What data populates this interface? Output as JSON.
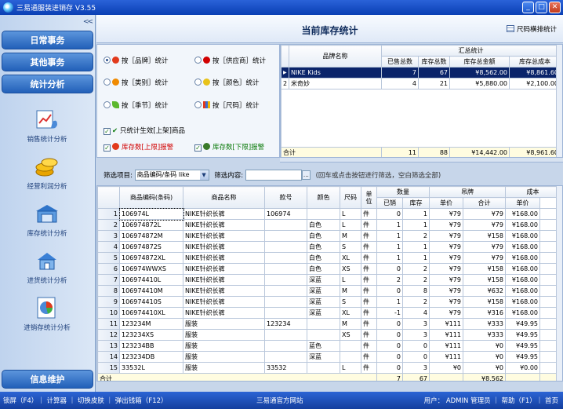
{
  "window": {
    "title": "三易通服装进销存 V3.55",
    "min": "_",
    "max": "□",
    "close": "✕"
  },
  "sidebar": {
    "collapse": "<<",
    "buttons": [
      "日常事务",
      "其他事务",
      "统计分析"
    ],
    "items": [
      {
        "label": "销售统计分析",
        "icon": "sales-chart-icon"
      },
      {
        "label": "经营利润分析",
        "icon": "coins-icon"
      },
      {
        "label": "库存统计分析",
        "icon": "warehouse-icon"
      },
      {
        "label": "进货统计分析",
        "icon": "house-icon"
      },
      {
        "label": "进销存统计分析",
        "icon": "pie-report-icon"
      }
    ],
    "bottom_button": "信息维护"
  },
  "header": {
    "title": "当前库存统计",
    "size_button": "尺码横排统计"
  },
  "options": {
    "radios": [
      {
        "label": "按［品牌］统计",
        "checked": true,
        "color": "#e23a1c"
      },
      {
        "label": "按［供应商］统计",
        "checked": false,
        "color": "#d10000"
      },
      {
        "label": "按［类别］统计",
        "checked": false,
        "color": "#f08a00"
      },
      {
        "label": "按［颜色］统计",
        "checked": false,
        "color": "#e8c21a"
      },
      {
        "label": "按［季节］统计",
        "checked": false,
        "color": "#5cb82e"
      },
      {
        "label": "按［尺码］统计",
        "checked": false,
        "color": "#3a6fd1"
      }
    ],
    "checks": [
      {
        "label": "只统计生效[上架]商品",
        "checked": true
      },
      {
        "label": "库存数[上限]报警",
        "checked": true
      },
      {
        "label": "库存数[下限]报警",
        "checked": true
      }
    ]
  },
  "brand_table": {
    "group_header": "汇总统计",
    "headers": [
      "品牌名称",
      "已售总数",
      "库存总数",
      "库存总金额",
      "库存总成本"
    ],
    "rows": [
      {
        "idx": "1",
        "name": "NIKE Kids",
        "sold": "7",
        "stock": "67",
        "amount": "¥8,562.00",
        "cost": "¥8,861.60",
        "selected": true
      },
      {
        "idx": "2",
        "name": "米奇妙",
        "sold": "4",
        "stock": "21",
        "amount": "¥5,880.00",
        "cost": "¥2,100.00",
        "selected": false
      }
    ],
    "total": {
      "label": "合计",
      "sold": "11",
      "stock": "88",
      "amount": "¥14,442.00",
      "cost": "¥8,961.60"
    }
  },
  "filter": {
    "label": "筛选项目:",
    "select_value": "商品编码/条码 like",
    "content_label": "筛选内容:",
    "hint": "(回车或点击按钮进行筛选，空白筛选全部)"
  },
  "grid": {
    "headers": {
      "code": "商品编码(条码)",
      "name": "商品名称",
      "style": "款号",
      "color": "颜色",
      "size": "尺码",
      "unit": "单位",
      "qty_group": "数量",
      "sold": "已销",
      "stock": "库存",
      "tag_group": "吊牌",
      "unit_price": "单价",
      "subtotal": "合计",
      "cost_group": "成本",
      "cost_price": "单价"
    },
    "rows": [
      {
        "n": "1",
        "code": "106974L",
        "name": "NIKE针织长裤",
        "style": "106974",
        "color": "",
        "size": "L",
        "unit": "件",
        "sold": "0",
        "stock": "1",
        "price": "¥79",
        "sum": "¥79",
        "cost": "¥168.00"
      },
      {
        "n": "2",
        "code": "106974872L",
        "name": "NIKE针织长裤",
        "style": "",
        "color": "白色",
        "size": "L",
        "unit": "件",
        "sold": "1",
        "stock": "1",
        "price": "¥79",
        "sum": "¥79",
        "cost": "¥168.00"
      },
      {
        "n": "3",
        "code": "106974872M",
        "name": "NIKE针织长裤",
        "style": "",
        "color": "白色",
        "size": "M",
        "unit": "件",
        "sold": "1",
        "stock": "2",
        "price": "¥79",
        "sum": "¥158",
        "cost": "¥168.00"
      },
      {
        "n": "4",
        "code": "106974872S",
        "name": "NIKE针织长裤",
        "style": "",
        "color": "白色",
        "size": "S",
        "unit": "件",
        "sold": "1",
        "stock": "1",
        "price": "¥79",
        "sum": "¥79",
        "cost": "¥168.00"
      },
      {
        "n": "5",
        "code": "106974872XL",
        "name": "NIKE针织长裤",
        "style": "",
        "color": "白色",
        "size": "XL",
        "unit": "件",
        "sold": "1",
        "stock": "1",
        "price": "¥79",
        "sum": "¥79",
        "cost": "¥168.00"
      },
      {
        "n": "6",
        "code": "106974WWXS",
        "name": "NIKE针织长裤",
        "style": "",
        "color": "白色",
        "size": "XS",
        "unit": "件",
        "sold": "0",
        "stock": "2",
        "price": "¥79",
        "sum": "¥158",
        "cost": "¥168.00"
      },
      {
        "n": "7",
        "code": "106974410L",
        "name": "NIKE针织长裤",
        "style": "",
        "color": "深蓝",
        "size": "L",
        "unit": "件",
        "sold": "2",
        "stock": "2",
        "price": "¥79",
        "sum": "¥158",
        "cost": "¥168.00"
      },
      {
        "n": "8",
        "code": "106974410M",
        "name": "NIKE针织长裤",
        "style": "",
        "color": "深蓝",
        "size": "M",
        "unit": "件",
        "sold": "0",
        "stock": "8",
        "price": "¥79",
        "sum": "¥632",
        "cost": "¥168.00"
      },
      {
        "n": "9",
        "code": "106974410S",
        "name": "NIKE针织长裤",
        "style": "",
        "color": "深蓝",
        "size": "S",
        "unit": "件",
        "sold": "1",
        "stock": "2",
        "price": "¥79",
        "sum": "¥158",
        "cost": "¥168.00"
      },
      {
        "n": "10",
        "code": "106974410XL",
        "name": "NIKE针织长裤",
        "style": "",
        "color": "深蓝",
        "size": "XL",
        "unit": "件",
        "sold": "-1",
        "stock": "4",
        "price": "¥79",
        "sum": "¥316",
        "cost": "¥168.00"
      },
      {
        "n": "11",
        "code": "123234M",
        "name": "服装",
        "style": "123234",
        "color": "",
        "size": "M",
        "unit": "件",
        "sold": "0",
        "stock": "3",
        "price": "¥111",
        "sum": "¥333",
        "cost": "¥49.95"
      },
      {
        "n": "12",
        "code": "123234XS",
        "name": "服装",
        "style": "",
        "color": "",
        "size": "XS",
        "unit": "件",
        "sold": "0",
        "stock": "3",
        "price": "¥111",
        "sum": "¥333",
        "cost": "¥49.95"
      },
      {
        "n": "13",
        "code": "123234BB",
        "name": "服装",
        "style": "",
        "color": "蓝色",
        "size": "",
        "unit": "件",
        "sold": "0",
        "stock": "0",
        "price": "¥111",
        "sum": "¥0",
        "cost": "¥49.95"
      },
      {
        "n": "14",
        "code": "123234DB",
        "name": "服装",
        "style": "",
        "color": "深蓝",
        "size": "",
        "unit": "件",
        "sold": "0",
        "stock": "0",
        "price": "¥111",
        "sum": "¥0",
        "cost": "¥49.95"
      },
      {
        "n": "15",
        "code": "33532L",
        "name": "服装",
        "style": "33532",
        "color": "",
        "size": "L",
        "unit": "件",
        "sold": "0",
        "stock": "3",
        "price": "¥0",
        "sum": "¥0",
        "cost": "¥0.00"
      }
    ],
    "total": {
      "label": "合计",
      "sold": "7",
      "stock": "67",
      "sum": "¥8,562"
    }
  },
  "statusbar": {
    "left": "锁屏（F4）｜ 计算器 ｜ 切换皮肤 ｜ 弹出钱箱（F12）",
    "center": "三易通官方网站",
    "right": "用户：  ADMIN 管理员  ｜  帮助（F1）｜ 首页"
  }
}
